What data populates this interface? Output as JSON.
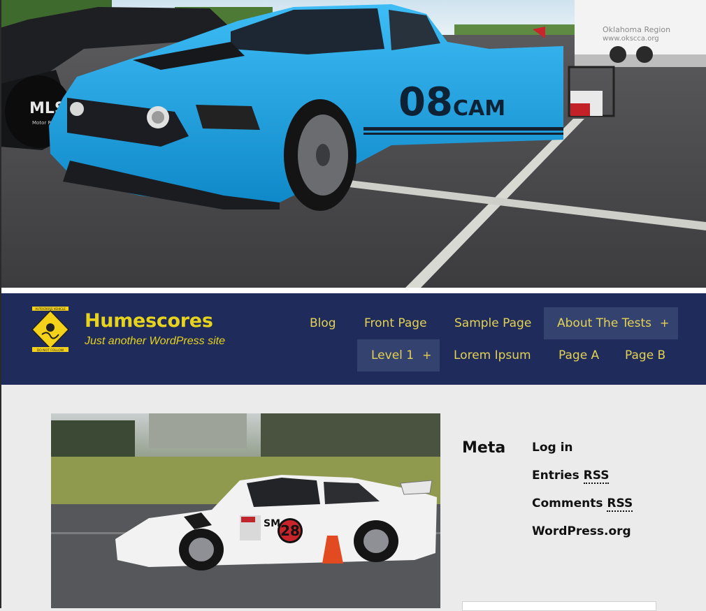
{
  "site": {
    "title": "Humescores",
    "tagline": "Just another WordPress site"
  },
  "hero": {
    "car_number": "08",
    "car_class": "CAM",
    "side_text": "MLS",
    "side_subtext": "Motor Racing",
    "trailer_text_1": "Oklahoma Region",
    "trailer_text_2": "www.okscca.org"
  },
  "logo": {
    "top_text": "AUTOCROSS VEHICLE",
    "bottom_text": "DO NOT FOLLOW"
  },
  "nav": {
    "items": [
      {
        "label": "Blog"
      },
      {
        "label": "Front Page"
      },
      {
        "label": "Sample Page"
      },
      {
        "label": "About The Tests",
        "submenu_indicator": "+"
      },
      {
        "label": "Level 1",
        "submenu_indicator": "+"
      },
      {
        "label": "Lorem Ipsum"
      },
      {
        "label": "Page A"
      },
      {
        "label": "Page B"
      }
    ]
  },
  "featured_image": {
    "class_label": "SM",
    "car_number": "28"
  },
  "sidebar": {
    "meta": {
      "title": "Meta",
      "links": [
        {
          "pre": "Log in",
          "abbr": ""
        },
        {
          "pre": "Entries ",
          "abbr": "RSS"
        },
        {
          "pre": "Comments ",
          "abbr": "RSS"
        },
        {
          "pre": "WordPress.org",
          "abbr": ""
        }
      ]
    }
  },
  "colors": {
    "masthead": "#1f2b5b",
    "accent_yellow": "#e7d31d",
    "nav_active": "#34426f",
    "car_blue": "#1aa6e6",
    "background": "#ebebeb"
  }
}
